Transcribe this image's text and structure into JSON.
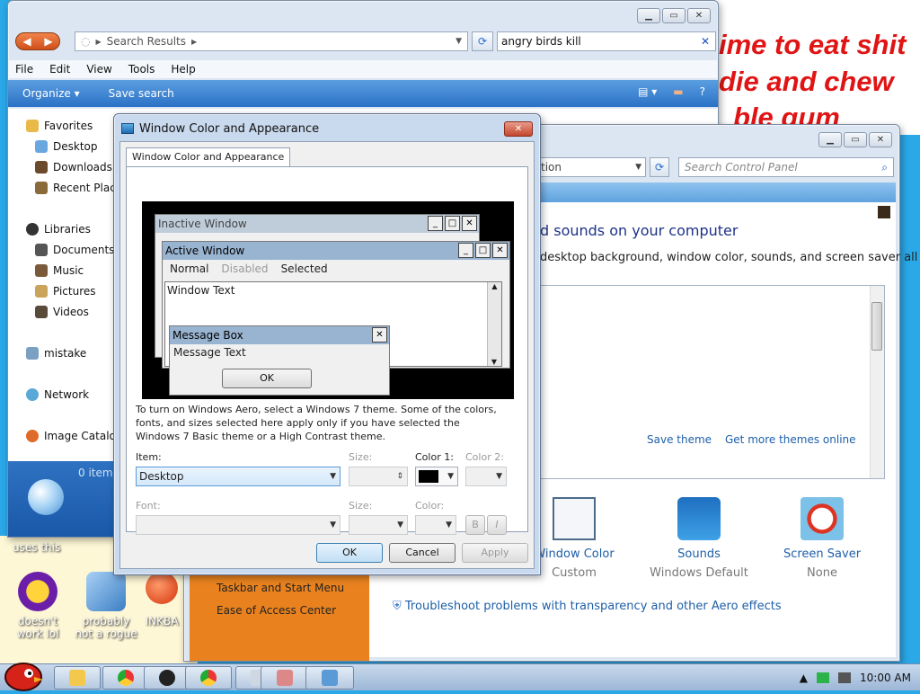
{
  "desktop": {
    "wallpaper_lines": [
      "ime to eat shit",
      "die and chew",
      "ble gum"
    ],
    "caption_uses_this": "uses this",
    "icons": [
      {
        "label1": "doesn't",
        "label2": "work lol"
      },
      {
        "label1": "probably",
        "label2": "not a rogue"
      },
      {
        "label1": "INKBA",
        "label2": ""
      }
    ]
  },
  "explorer": {
    "address": "Search Results",
    "search_value": "angry birds kill",
    "menu": [
      "File",
      "Edit",
      "View",
      "Tools",
      "Help"
    ],
    "organize": "Organize ▾",
    "save_search": "Save search",
    "nav": {
      "favorites": "Favorites",
      "desktop": "Desktop",
      "downloads": "Downloads",
      "recent": "Recent Plac",
      "libraries": "Libraries",
      "documents": "Documents",
      "music": "Music",
      "pictures": "Pictures",
      "videos": "Videos",
      "mistake": "mistake",
      "network": "Network",
      "image_catalog": "Image Catalo"
    },
    "detail_items": "0 item"
  },
  "personalization": {
    "address_fragment": "tion",
    "search_placeholder": "Search Control Panel",
    "heading": "d sounds on your computer",
    "subheading": "desktop background, window color, sounds, and screen saver all",
    "save_theme": "Save theme",
    "get_more": "Get more themes online",
    "left_links": [
      "Taskbar and Start Menu",
      "Ease of Access Center"
    ],
    "items": [
      {
        "title": "Window Color",
        "value": "Custom"
      },
      {
        "title": "Sounds",
        "value": "Windows Default"
      },
      {
        "title": "Screen Saver",
        "value": "None"
      }
    ],
    "troubleshoot": "Troubleshoot problems with transparency and other Aero effects"
  },
  "dialog": {
    "title": "Window Color and Appearance",
    "tab": "Window Color and Appearance",
    "preview": {
      "inactive": "Inactive Window",
      "active": "Active Window",
      "menu": [
        "Normal",
        "Disabled",
        "Selected"
      ],
      "window_text": "Window Text",
      "message_box": "Message Box",
      "message_text": "Message Text",
      "ok": "OK"
    },
    "info": "To turn on Windows Aero, select a Windows 7 theme.  Some of the colors, fonts, and sizes selected here apply only if you have selected the Windows 7 Basic theme or a High Contrast theme.",
    "item_label": "Item:",
    "item_value": "Desktop",
    "size_label": "Size:",
    "color1_label": "Color 1:",
    "color2_label": "Color 2:",
    "font_label": "Font:",
    "font_size_label": "Size:",
    "font_color_label": "Color:",
    "bold": "B",
    "italic": "I",
    "ok": "OK",
    "cancel": "Cancel",
    "apply": "Apply"
  },
  "taskbar": {
    "time": "10:00 AM",
    "show_hidden": "▲"
  }
}
